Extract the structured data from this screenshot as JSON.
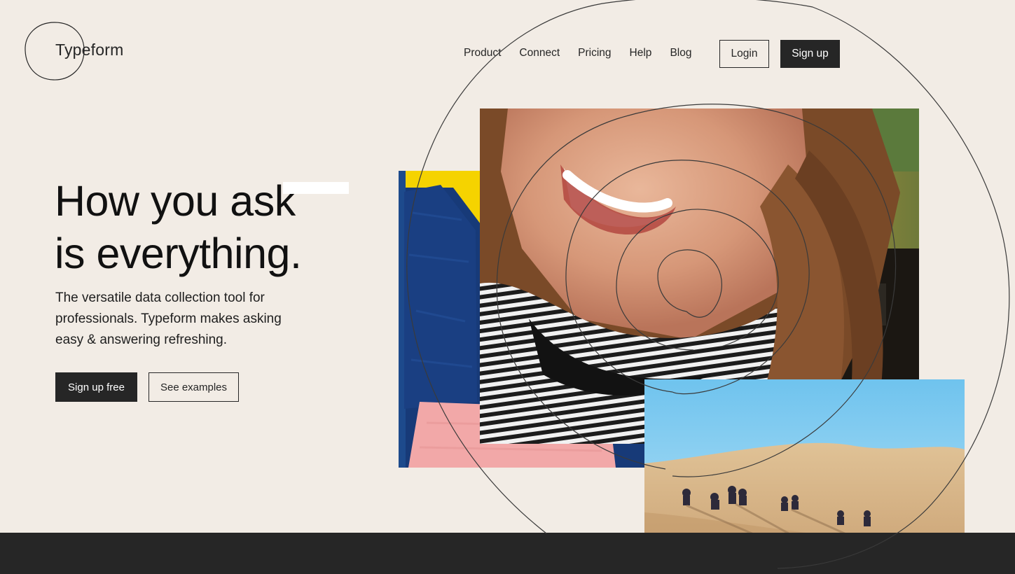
{
  "logo": {
    "text": "Typeform"
  },
  "nav": {
    "links": [
      "Product",
      "Connect",
      "Pricing",
      "Help",
      "Blog"
    ],
    "login_label": "Login",
    "signup_label": "Sign up"
  },
  "hero": {
    "title_line1": "How you ask",
    "title_line2": "is everything.",
    "subtitle": "The versatile data collection tool for professionals. Typeform makes asking easy & answering refreshing.",
    "primary_cta": "Sign up free",
    "secondary_cta": "See examples"
  },
  "colors": {
    "background": "#f2ece5",
    "dark": "#262626",
    "accent_yellow": "#f5d300",
    "accent_navy": "#173a78",
    "accent_pink": "#f2a8a8",
    "sky_blue": "#7ecbf0",
    "sand": "#d9b98a"
  }
}
